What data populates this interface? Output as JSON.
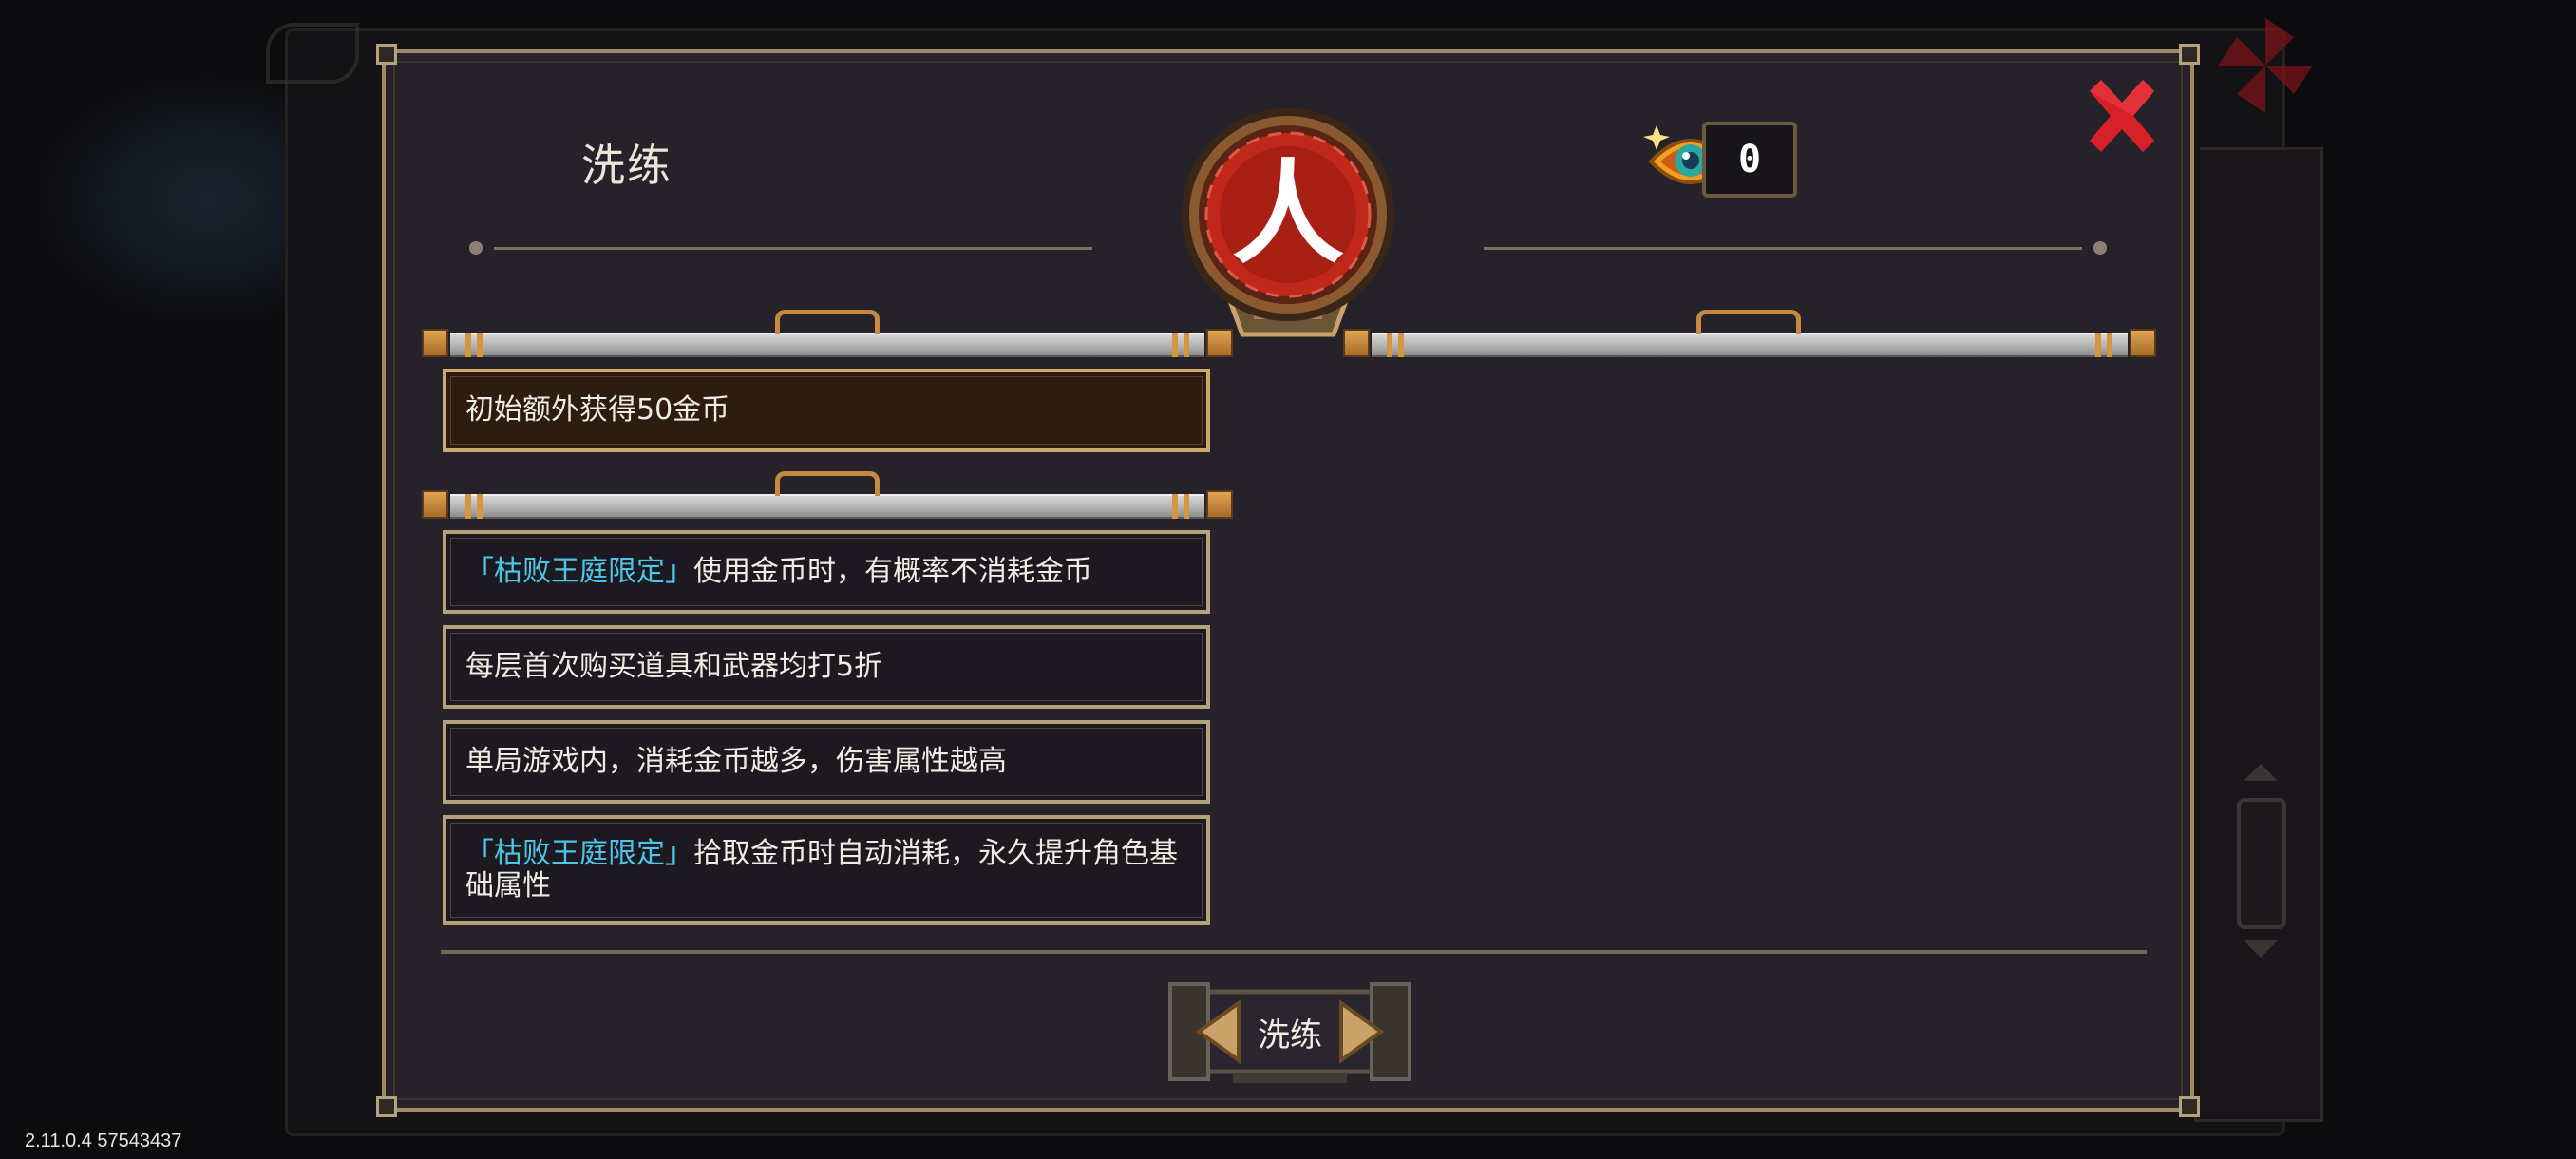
{
  "dialog": {
    "title": "洗练",
    "currency_count": "0"
  },
  "slots": [
    {
      "tag": "",
      "text": "初始额外获得50金币",
      "selected": true
    }
  ],
  "options": [
    {
      "tag": "「枯败王庭限定」",
      "text": "使用金币时，有概率不消耗金币"
    },
    {
      "tag": "",
      "text": "每层首次购买道具和武器均打5折"
    },
    {
      "tag": "",
      "text": "单局游戏内，消耗金币越多，伤害属性越高"
    },
    {
      "tag": "「枯败王庭限定」",
      "text": "拾取金币时自动消耗，永久提升角色基础属性"
    }
  ],
  "emblem": {
    "glyph": "人"
  },
  "refine_button": {
    "label": "洗练"
  },
  "footer": {
    "version": "2.11.0.4 57543437"
  },
  "colors": {
    "tag_blue": "#4cc6e8",
    "close_red": "#d8202a",
    "emblem_red": "#c0281c",
    "frame_gold": "#b4a27a"
  },
  "icons": [
    "close-icon",
    "eye-gem-icon",
    "emblem-icon",
    "arrow-left-icon",
    "arrow-right-icon"
  ]
}
